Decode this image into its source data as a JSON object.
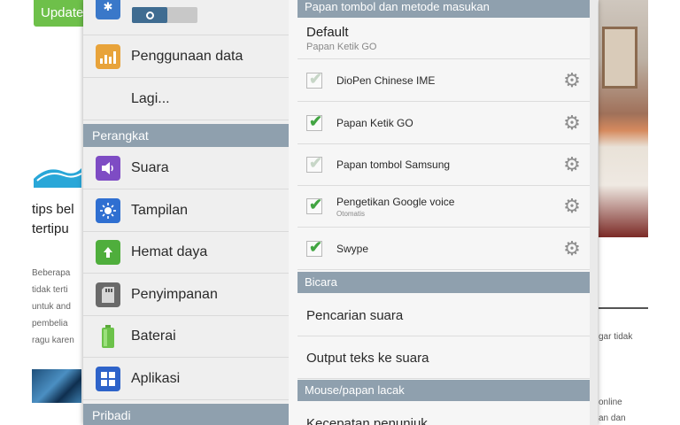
{
  "background_page": {
    "update_button": "Update",
    "article_title": "tips bel\ntertipu",
    "article_body": "Beberapa\ntidak terti\nuntuk and\npembelia\nragu karen",
    "right_text_1": "gar tidak",
    "right_text_2": "online\nan dan"
  },
  "colors": {
    "section_header": "#8fa0ae",
    "checkbox_green": "#42a542",
    "update_green": "#6ec04a",
    "toggle_blue": "#3f6c91"
  },
  "left_menu": {
    "top_icon": "bluetooth-icon",
    "items_a": [
      {
        "label": "Penggunaan data",
        "icon": "data-usage-icon"
      },
      {
        "label": "Lagi...",
        "icon": ""
      }
    ],
    "section_device": "Perangkat",
    "items_b": [
      {
        "label": "Suara",
        "icon": "sound-icon"
      },
      {
        "label": "Tampilan",
        "icon": "display-icon"
      },
      {
        "label": "Hemat daya",
        "icon": "power-saving-icon"
      },
      {
        "label": "Penyimpanan",
        "icon": "storage-icon"
      },
      {
        "label": "Baterai",
        "icon": "battery-icon"
      },
      {
        "label": "Aplikasi",
        "icon": "apps-icon"
      }
    ],
    "section_personal": "Pribadi"
  },
  "right_panel": {
    "section_keyboard": "Papan tombol dan metode masukan",
    "default_title": "Default",
    "default_value": "Papan Ketik GO",
    "keyboards": [
      {
        "label": "DioPen Chinese IME",
        "sub": "",
        "checked": true,
        "enabled": false
      },
      {
        "label": "Papan Ketik GO",
        "sub": "",
        "checked": true,
        "enabled": true
      },
      {
        "label": "Papan tombol Samsung",
        "sub": "",
        "checked": true,
        "enabled": false
      },
      {
        "label": "Pengetikan Google voice",
        "sub": "Otomatis",
        "checked": true,
        "enabled": true
      },
      {
        "label": "Swype",
        "sub": "",
        "checked": true,
        "enabled": true
      }
    ],
    "section_speech": "Bicara",
    "speech_items": [
      "Pencarian suara",
      "Output teks ke suara"
    ],
    "section_mouse": "Mouse/papan lacak",
    "mouse_items": [
      "Kecepatan penunjuk"
    ]
  }
}
